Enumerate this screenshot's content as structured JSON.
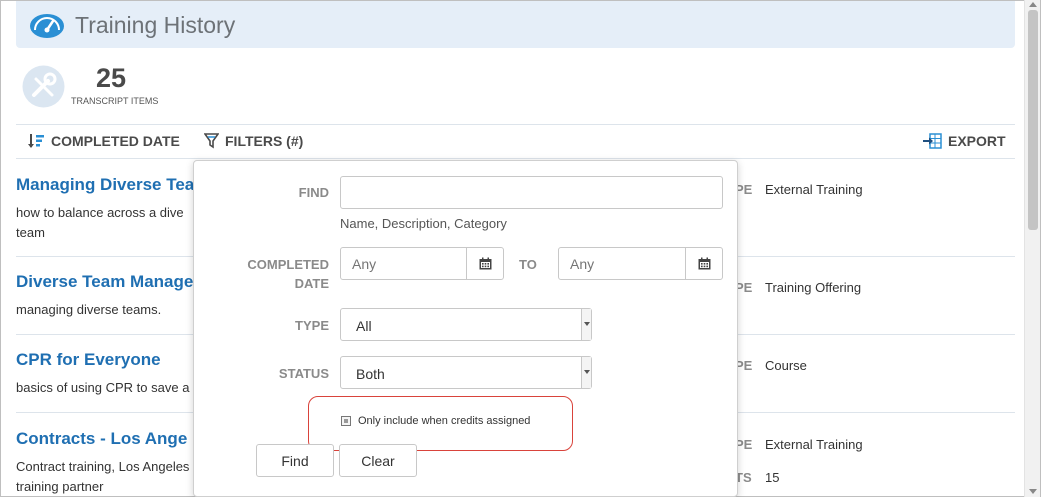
{
  "header": {
    "title": "Training History"
  },
  "summary": {
    "count": "25",
    "count_label": "TRANSCRIPT ITEMS"
  },
  "toolbar": {
    "sort_label": "COMPLETED DATE",
    "filters_label": "FILTERS (#)",
    "export_label": "EXPORT"
  },
  "rows": [
    {
      "title": "Managing Diverse Tea",
      "desc": "how to balance across a dive team",
      "type_label": "PE",
      "type": "External Training"
    },
    {
      "title": "Diverse Team Manage",
      "desc": "managing diverse teams.",
      "type_label": "PE",
      "type": "Training Offering"
    },
    {
      "title": "CPR for Everyone",
      "desc": "basics of using CPR to save a",
      "type_label": "PE",
      "type": "Course"
    },
    {
      "title": "Contracts - Los Ange",
      "desc": "Contract training, Los Angeles training partner",
      "type_label": "PE",
      "type": "External Training",
      "extra_label": "TS",
      "extra_value": "15"
    }
  ],
  "filters": {
    "find_label": "FIND",
    "find_value": "",
    "find_hint": "Name, Description, Category",
    "completed_label_1": "COMPLETED",
    "completed_label_2": "DATE",
    "from_placeholder": "Any",
    "to_label": "TO",
    "to_placeholder": "Any",
    "type_label": "TYPE",
    "type_value": "All",
    "status_label": "STATUS",
    "status_value": "Both",
    "credits_checkbox": "Only include when credits assigned",
    "find_button": "Find",
    "clear_button": "Clear"
  },
  "colors": {
    "accent": "#1f6fb2",
    "header_bg": "#e5eef8",
    "highlight": "#d9433b"
  }
}
